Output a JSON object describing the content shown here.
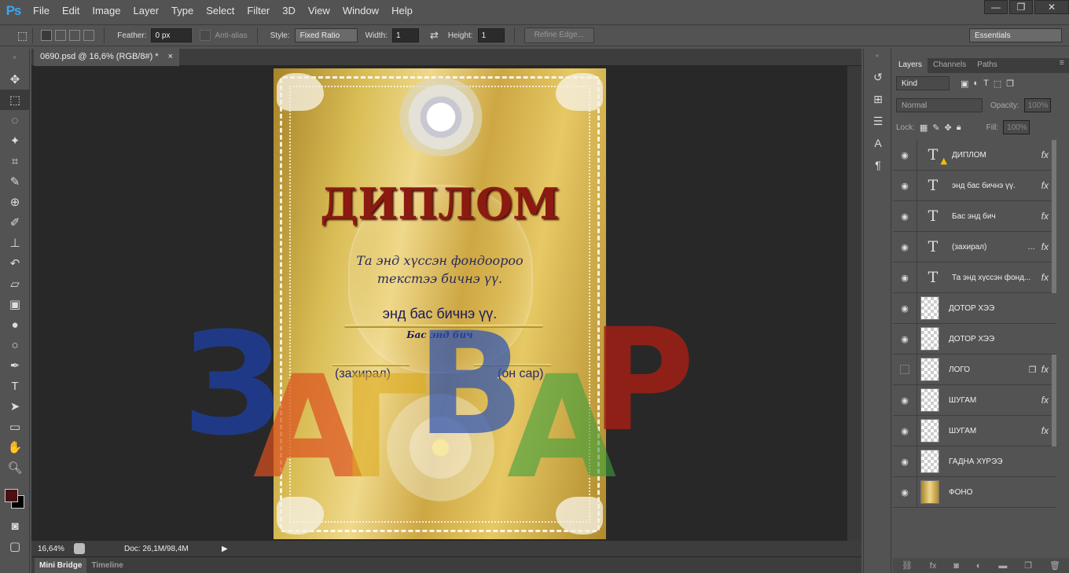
{
  "app": {
    "logo": "Ps"
  },
  "menu": [
    "File",
    "Edit",
    "Image",
    "Layer",
    "Type",
    "Select",
    "Filter",
    "3D",
    "View",
    "Window",
    "Help"
  ],
  "window_controls": {
    "minimize": "—",
    "restore": "❐",
    "close": "✕"
  },
  "options": {
    "feather_label": "Feather:",
    "feather_value": "0 px",
    "antialias_label": "Anti-alias",
    "style_label": "Style:",
    "style_value": "Fixed Ratio",
    "width_label": "Width:",
    "width_value": "1",
    "height_label": "Height:",
    "height_value": "1",
    "refine_label": "Refine Edge...",
    "workspace": "Essentials"
  },
  "document": {
    "tab_title": "0690.psd @ 16,6% (RGB/8#) *",
    "tab_close": "×"
  },
  "canvas_text": {
    "title": "ДИПЛОМ",
    "line1": "Та энд хүссэн фондоороо",
    "line2": "текстээ бичнэ үү.",
    "name": "энд бас бичнэ үү.",
    "sub": "Бас энд бич",
    "left_sign": "(захирал)",
    "right_sign": "(он сар)"
  },
  "watermark": {
    "letters": [
      "З",
      "А",
      "Г",
      "В",
      "А",
      "Р"
    ]
  },
  "status": {
    "zoom": "16,64%",
    "doc": "Doc: 26,1M/98,4M"
  },
  "bottom_tabs": [
    "Mini Bridge",
    "Timeline"
  ],
  "panel_tabs": [
    "Layers",
    "Channels",
    "Paths"
  ],
  "layers_controls": {
    "kind": "Kind",
    "blend": "Normal",
    "opacity_label": "Opacity:",
    "opacity_value": "100%",
    "lock_label": "Lock:",
    "fill_label": "Fill:",
    "fill_value": "100%"
  },
  "layers": [
    {
      "name": "ДИПЛОМ",
      "type": "text",
      "fx": "fx",
      "warning": true
    },
    {
      "name": "энд бас бичнэ үү.",
      "type": "text",
      "fx": "fx"
    },
    {
      "name": "Бас энд бич",
      "type": "text",
      "fx": "fx"
    },
    {
      "name": "(захирал)",
      "type": "text",
      "fx": "fx",
      "extra": "..."
    },
    {
      "name": "Та энд хүссэн фонд...",
      "type": "text",
      "fx": "fx"
    },
    {
      "name": "ДОТОР ХЭЭ",
      "type": "image"
    },
    {
      "name": "ДОТОР ХЭЭ",
      "type": "image"
    },
    {
      "name": "ЛОГО",
      "type": "image",
      "fx": "fx",
      "hidden": true
    },
    {
      "name": "ШУГАМ",
      "type": "image",
      "fx": "fx"
    },
    {
      "name": "ШУГАМ",
      "type": "image",
      "fx": "fx"
    },
    {
      "name": "ГАДНА ХҮРЭЭ",
      "type": "image"
    },
    {
      "name": "ФОНО",
      "type": "gold"
    }
  ],
  "colors": {
    "foreground": "#4a1010",
    "background": "#000000",
    "accent_text": "#8b1a10",
    "gold": "#d9bd55"
  }
}
